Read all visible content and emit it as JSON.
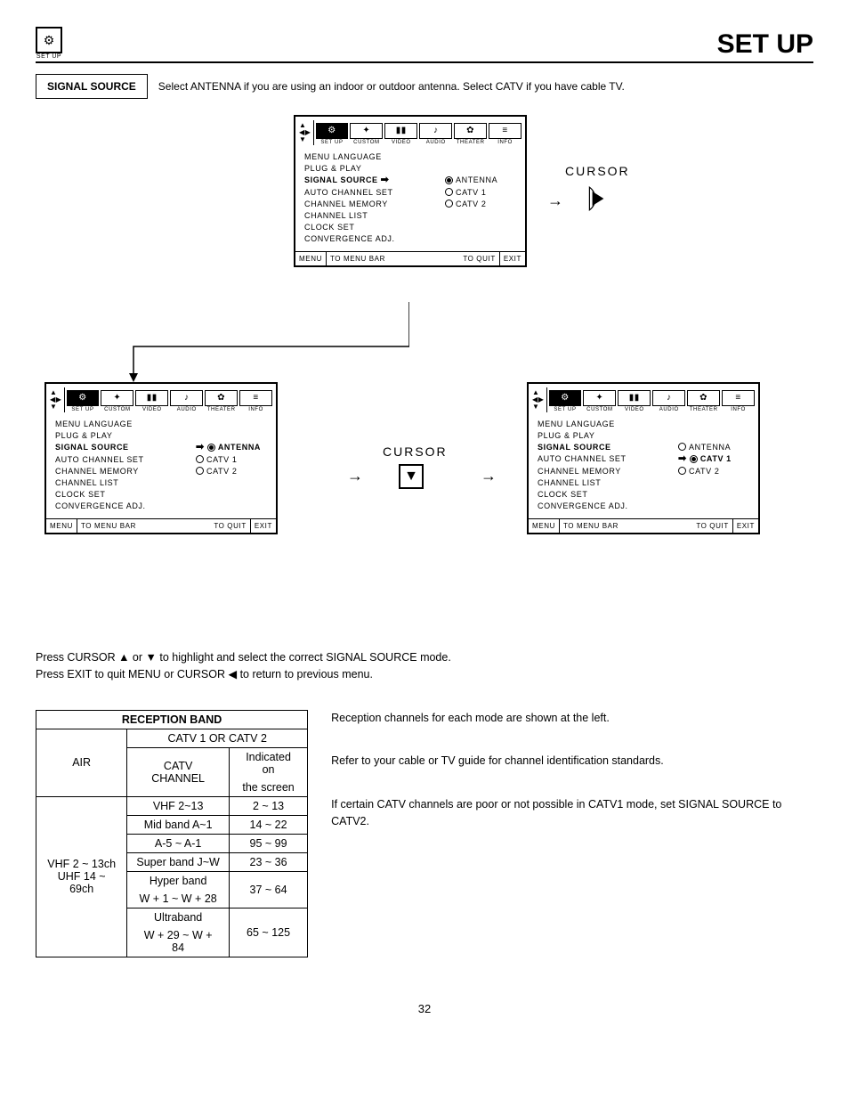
{
  "header": {
    "icon_label": "SET UP",
    "title": "SET UP"
  },
  "signal": {
    "label": "SIGNAL SOURCE",
    "text": "Select ANTENNA if you are using an indoor or outdoor antenna.  Select CATV if you have cable TV."
  },
  "osd_tabs": [
    "SET UP",
    "CUSTOM",
    "VIDEO",
    "AUDIO",
    "THEATER",
    "INFO"
  ],
  "osd_menu": {
    "items": [
      "MENU LANGUAGE",
      "PLUG & PLAY",
      "SIGNAL SOURCE",
      "AUTO CHANNEL SET",
      "CHANNEL MEMORY",
      "CHANNEL LIST",
      "CLOCK SET",
      "CONVERGENCE ADJ."
    ],
    "options": [
      "ANTENNA",
      "CATV 1",
      "CATV 2"
    ]
  },
  "osd_foot": {
    "menu": "MENU",
    "menubar": "TO MENU BAR",
    "quit": "TO QUIT",
    "exit": "EXIT"
  },
  "cursor_label": "CURSOR",
  "instructions": {
    "l1": "Press CURSOR ▲ or ▼ to highlight and select the correct SIGNAL SOURCE mode.",
    "l2": "Press EXIT to quit MENU or CURSOR ◀ to return to previous menu."
  },
  "table": {
    "title": "RECEPTION BAND",
    "catv_header": "CATV 1 OR CATV 2",
    "air_header": "AIR",
    "catv_channel": "CATV CHANNEL",
    "indicated1": "Indicated on",
    "indicated2": "the screen",
    "air_rows": [
      "VHF 2 ~ 13ch",
      "UHF 14 ~ 69ch"
    ],
    "rows": [
      {
        "c": "VHF 2~13",
        "i": "2 ~ 13"
      },
      {
        "c": "Mid band A~1",
        "i": "14 ~ 22"
      },
      {
        "c": "A-5 ~ A-1",
        "i": "95 ~ 99"
      },
      {
        "c": "Super band J~W",
        "i": "23 ~ 36"
      },
      {
        "c": "Hyper band",
        "i": "37 ~ 64"
      },
      {
        "c": "W + 1 ~ W + 28",
        "i": ""
      },
      {
        "c": "Ultraband",
        "i": "65 ~ 125"
      },
      {
        "c": "W + 29 ~ W + 84",
        "i": ""
      }
    ]
  },
  "right_text": {
    "p1": "Reception channels for each mode are shown at the left.",
    "p2": "Refer to your cable or TV guide for channel identification standards.",
    "p3": "If certain CATV channels are poor or not possible in CATV1 mode, set SIGNAL SOURCE to CATV2."
  },
  "page_number": "32"
}
